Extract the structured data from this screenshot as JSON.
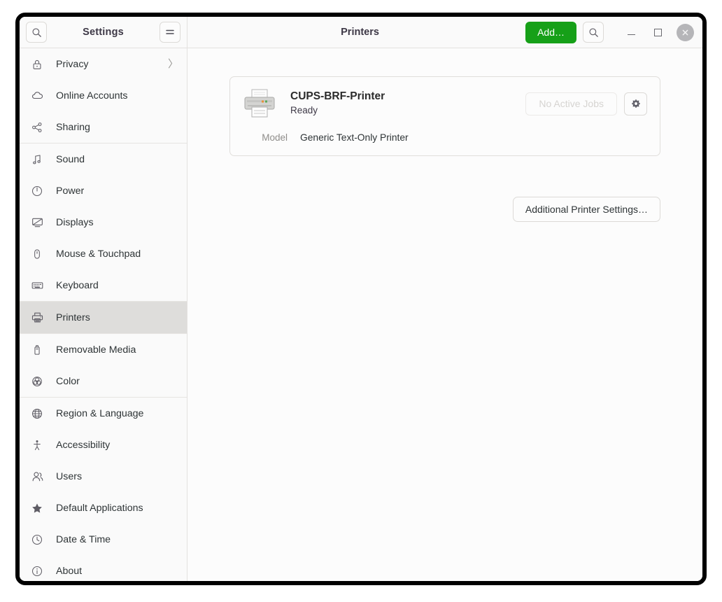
{
  "window": {
    "settings_title": "Settings",
    "page_title": "Printers",
    "add_button": "Add…",
    "controls": {
      "minimize": "–",
      "maximize": "□",
      "close": "×"
    }
  },
  "sidebar": {
    "items": [
      {
        "label": "Privacy",
        "icon": "lock-icon",
        "selected": false,
        "chevron": "〉",
        "sep_after": false
      },
      {
        "label": "Online Accounts",
        "icon": "cloud-icon",
        "selected": false,
        "chevron": "",
        "sep_after": false
      },
      {
        "label": "Sharing",
        "icon": "share-nodes-icon",
        "selected": false,
        "chevron": "",
        "sep_after": true
      },
      {
        "label": "Sound",
        "icon": "music-note-icon",
        "selected": false,
        "chevron": "",
        "sep_after": false
      },
      {
        "label": "Power",
        "icon": "power-icon",
        "selected": false,
        "chevron": "",
        "sep_after": false
      },
      {
        "label": "Displays",
        "icon": "display-icon",
        "selected": false,
        "chevron": "",
        "sep_after": false
      },
      {
        "label": "Mouse & Touchpad",
        "icon": "mouse-icon",
        "selected": false,
        "chevron": "",
        "sep_after": false
      },
      {
        "label": "Keyboard",
        "icon": "keyboard-icon",
        "selected": false,
        "chevron": "",
        "sep_after": true
      },
      {
        "label": "Printers",
        "icon": "printer-icon",
        "selected": true,
        "chevron": "",
        "sep_after": true
      },
      {
        "label": "Removable Media",
        "icon": "usb-drive-icon",
        "selected": false,
        "chevron": "",
        "sep_after": false
      },
      {
        "label": "Color",
        "icon": "color-wheel-icon",
        "selected": false,
        "chevron": "",
        "sep_after": true
      },
      {
        "label": "Region & Language",
        "icon": "globe-icon",
        "selected": false,
        "chevron": "",
        "sep_after": false
      },
      {
        "label": "Accessibility",
        "icon": "accessibility-icon",
        "selected": false,
        "chevron": "",
        "sep_after": false
      },
      {
        "label": "Users",
        "icon": "users-icon",
        "selected": false,
        "chevron": "",
        "sep_after": false
      },
      {
        "label": "Default Applications",
        "icon": "star-icon",
        "selected": false,
        "chevron": "",
        "sep_after": false
      },
      {
        "label": "Date & Time",
        "icon": "clock-icon",
        "selected": false,
        "chevron": "",
        "sep_after": false
      },
      {
        "label": "About",
        "icon": "info-icon",
        "selected": false,
        "chevron": "",
        "sep_after": false
      }
    ]
  },
  "main": {
    "printer": {
      "name": "CUPS-BRF-Printer",
      "status": "Ready",
      "jobs_button": "No Active Jobs",
      "model_label": "Model",
      "model_value": "Generic Text-Only Printer"
    },
    "additional_settings_button": "Additional Printer Settings…"
  },
  "colors": {
    "accent_green": "#16a018",
    "selected_row": "#dedddb",
    "window_border": "#000000",
    "header_bg": "#fafafa"
  }
}
